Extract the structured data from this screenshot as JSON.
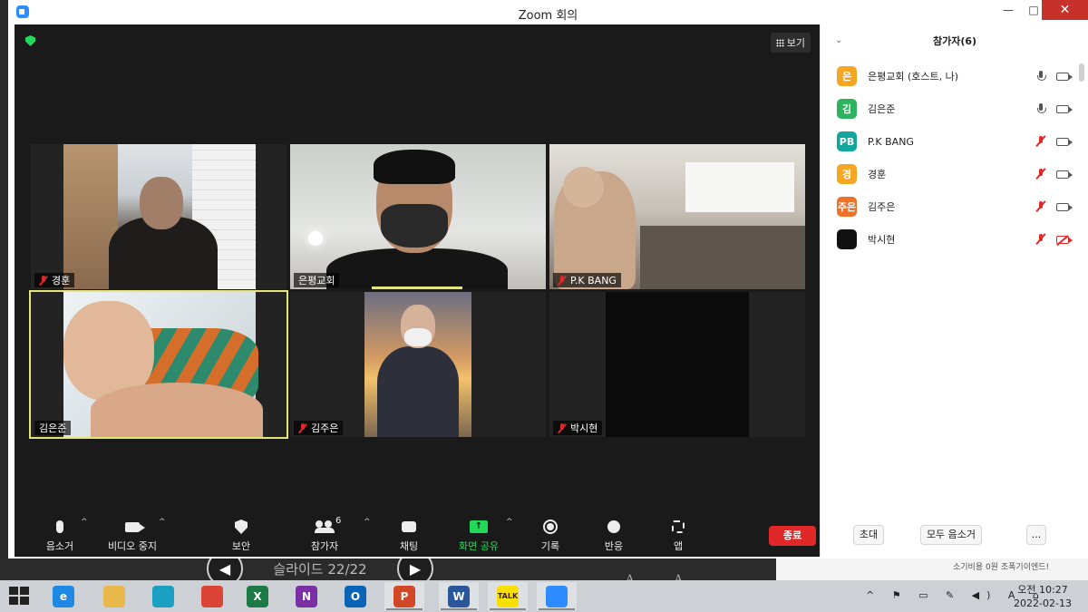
{
  "window": {
    "title": "Zoom 회의",
    "minimize": "—",
    "maximize": "□",
    "close": "✕"
  },
  "meeting": {
    "view_label": "보기",
    "tiles": [
      {
        "name": "경훈",
        "muted": true
      },
      {
        "name": "은평교회",
        "muted": false
      },
      {
        "name": "P.K BANG",
        "muted": true
      },
      {
        "name": "김은준",
        "muted": false
      },
      {
        "name": "김주은",
        "muted": true
      },
      {
        "name": "박시현",
        "muted": true
      }
    ]
  },
  "toolbar": {
    "mute": "음소거",
    "video_stop": "비디오 중지",
    "security": "보안",
    "participants": "참가자",
    "participants_count": "6",
    "chat": "채팅",
    "share_screen": "화면 공유",
    "record": "기록",
    "reactions": "반응",
    "apps": "앱",
    "end": "종료",
    "caret": "^"
  },
  "panel": {
    "title": "참가자(6)",
    "participants": [
      {
        "initials": "은",
        "name": "은평교회 (호스트, 나)",
        "color": "#f5a623",
        "mic": "on",
        "cam": "on"
      },
      {
        "initials": "김",
        "name": "김은준",
        "color": "#2db35d",
        "mic": "on",
        "cam": "on"
      },
      {
        "initials": "PB",
        "name": "P.K BANG",
        "color": "#12a79d",
        "mic": "muted",
        "cam": "on"
      },
      {
        "initials": "경",
        "name": "경훈",
        "color": "#f5a623",
        "mic": "muted",
        "cam": "on"
      },
      {
        "initials": "주은",
        "name": "김주은",
        "color": "#f0712a",
        "mic": "muted",
        "cam": "on"
      },
      {
        "initials": "",
        "name": "박시현",
        "color": "#111111",
        "mic": "muted",
        "cam": "off"
      }
    ],
    "invite": "초대",
    "mute_all": "모두 음소거",
    "more": "..."
  },
  "background": {
    "slide_label": "슬라이드 22/22",
    "prev": "◀",
    "next": "▶",
    "font_controls": "A A",
    "banner_text": "소기비용 0원 조폭기이엔드!"
  },
  "taskbar": {
    "apps": [
      {
        "name": "internet-explorer",
        "label": "e",
        "color": "#1e88e5"
      },
      {
        "name": "file-explorer",
        "label": "",
        "color": "#e8b84a"
      },
      {
        "name": "edge",
        "label": "",
        "color": "#1ba0c4"
      },
      {
        "name": "chrome",
        "label": "",
        "color": "#db4437"
      },
      {
        "name": "excel",
        "label": "X",
        "color": "#1d7a45"
      },
      {
        "name": "onenote",
        "label": "N",
        "color": "#7b2fa5"
      },
      {
        "name": "outlook",
        "label": "O",
        "color": "#0a64b5"
      },
      {
        "name": "powerpoint",
        "label": "P",
        "color": "#d24726"
      },
      {
        "name": "word",
        "label": "W",
        "color": "#2b579a"
      },
      {
        "name": "kakaotalk",
        "label": "TALK",
        "color": "#f9e000"
      },
      {
        "name": "zoom",
        "label": "",
        "color": "#2d8cff"
      }
    ],
    "tray": "^ ⚑ ▭ ✎ ◀) A ⌂",
    "time": "오전 10:27",
    "date": "2022-02-13"
  }
}
